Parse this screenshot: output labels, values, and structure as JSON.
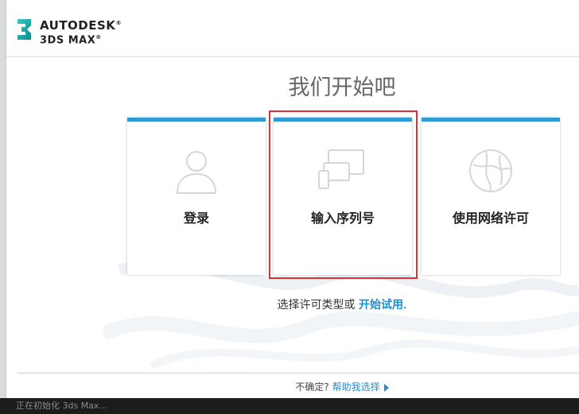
{
  "brand": {
    "logo_numeral": "3",
    "line1": "AUTODESK",
    "line2": "3DS MAX",
    "mark": "®"
  },
  "title": "我们开始吧",
  "cards": [
    {
      "label": "登录",
      "icon": "user-icon"
    },
    {
      "label": "输入序列号",
      "icon": "devices-icon"
    },
    {
      "label": "使用网络许可",
      "icon": "network-globe-icon"
    }
  ],
  "colors": {
    "accent": "#2e9bd6",
    "link": "#1a8fd2",
    "highlight": "#e0302f"
  },
  "hint": {
    "prefix": "选择许可类型或 ",
    "link": "开始试用",
    "suffix": "."
  },
  "help": {
    "prefix": "不确定? ",
    "link": "帮助我选择"
  },
  "status": "正在初始化 3ds Max..."
}
